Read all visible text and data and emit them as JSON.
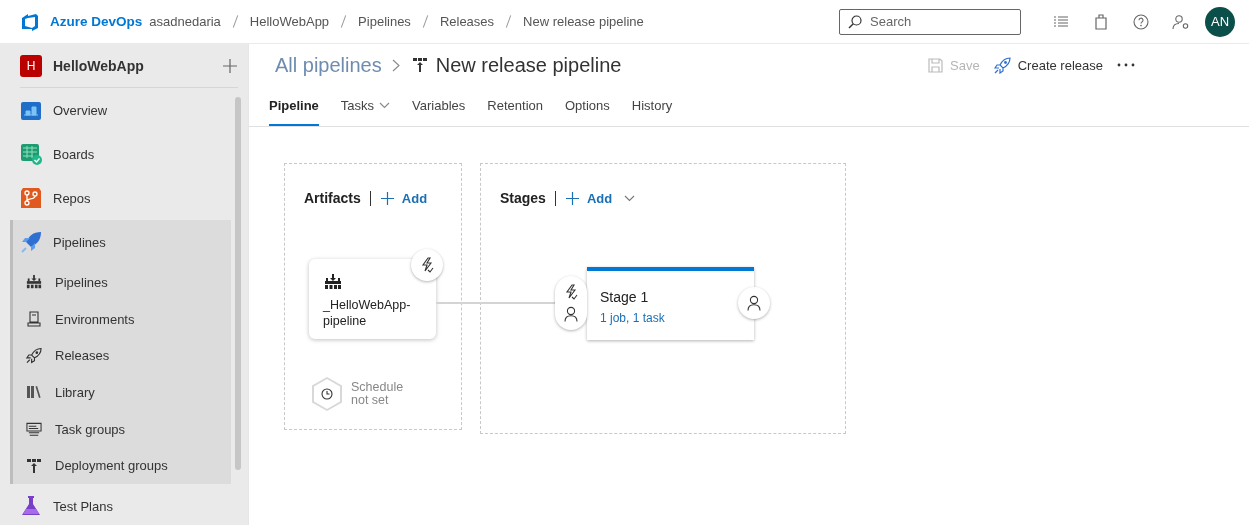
{
  "topbar": {
    "brand": "Azure DevOps",
    "breadcrumbs": [
      "asadnedaria",
      "HelloWebApp",
      "Pipelines",
      "Releases",
      "New release pipeline"
    ],
    "search": {
      "placeholder": "Search"
    },
    "avatar": "AN"
  },
  "sidebar": {
    "project": {
      "badge": "H",
      "name": "HelloWebApp"
    },
    "items": [
      {
        "label": "Overview",
        "selected": false
      },
      {
        "label": "Boards",
        "selected": false
      },
      {
        "label": "Repos",
        "selected": false
      },
      {
        "label": "Pipelines",
        "selected": true,
        "children": [
          {
            "label": "Pipelines",
            "selected": false
          },
          {
            "label": "Environments",
            "selected": false
          },
          {
            "label": "Releases",
            "selected": false
          },
          {
            "label": "Library",
            "selected": false
          },
          {
            "label": "Task groups",
            "selected": false
          },
          {
            "label": "Deployment groups",
            "selected": false
          }
        ]
      },
      {
        "label": "Test Plans",
        "selected": false
      }
    ]
  },
  "header": {
    "parent_link": "All pipelines",
    "title": "New release pipeline",
    "actions": [
      {
        "label": "Save",
        "disabled": true
      },
      {
        "label": "Create release",
        "disabled": false
      }
    ]
  },
  "tabs": [
    {
      "label": "Pipeline",
      "selected": true,
      "dropdown": false
    },
    {
      "label": "Tasks",
      "selected": false,
      "dropdown": true
    },
    {
      "label": "Variables",
      "selected": false,
      "dropdown": false
    },
    {
      "label": "Retention",
      "selected": false,
      "dropdown": false
    },
    {
      "label": "Options",
      "selected": false,
      "dropdown": false
    },
    {
      "label": "History",
      "selected": false,
      "dropdown": false
    }
  ],
  "pipeline": {
    "artifacts": {
      "title": "Artifacts",
      "add_label": "Add",
      "add_dropdown": false,
      "items": [
        {
          "name": "_HelloWebApp-pipeline"
        }
      ],
      "schedule": "Schedule not set"
    },
    "stages": {
      "title": "Stages",
      "add_label": "Add",
      "add_dropdown": true,
      "items": [
        {
          "name": "Stage 1",
          "summary": "1 job, 1 task"
        }
      ]
    }
  }
}
